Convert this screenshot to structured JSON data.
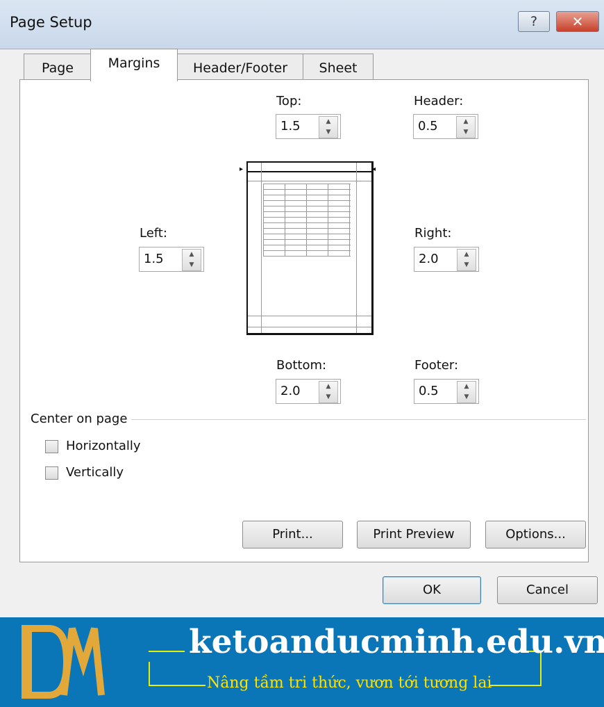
{
  "window": {
    "title": "Page Setup",
    "help_label": "?",
    "close_label": "✕"
  },
  "tabs": [
    {
      "label": "Page"
    },
    {
      "label": "Margins"
    },
    {
      "label": "Header/Footer"
    },
    {
      "label": "Sheet"
    }
  ],
  "margins": {
    "top": {
      "label": "Top:",
      "value": "1.5"
    },
    "header": {
      "label": "Header:",
      "value": "0.5"
    },
    "left": {
      "label": "Left:",
      "value": "1.5"
    },
    "right": {
      "label": "Right:",
      "value": "2.0"
    },
    "bottom": {
      "label": "Bottom:",
      "value": "2.0"
    },
    "footer": {
      "label": "Footer:",
      "value": "0.5"
    }
  },
  "center_on_page": {
    "label": "Center on page",
    "horizontally": {
      "label": "Horizontally",
      "checked": false
    },
    "vertically": {
      "label": "Vertically",
      "checked": false
    }
  },
  "buttons": {
    "print": "Print...",
    "print_preview": "Print Preview",
    "options": "Options...",
    "ok": "OK",
    "cancel": "Cancel"
  },
  "banner": {
    "logo_text": "DM",
    "site": "ketoanducminh.edu.vn",
    "slogan": "Nâng tầm tri thức, vươn tới tương lai"
  },
  "colors": {
    "banner_bg": "#0a75b7",
    "logo_gold": "#e2a93a",
    "slogan_yellow": "#ffe300"
  }
}
